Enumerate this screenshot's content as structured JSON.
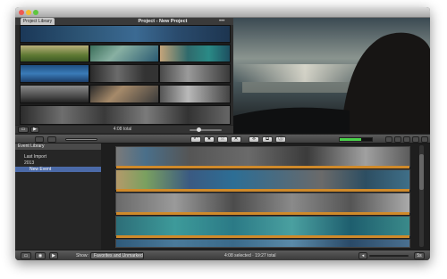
{
  "window": {
    "project_library_tab": "Project Library",
    "project_title": "Project - New Project",
    "more_dots": "•••"
  },
  "project_footer": {
    "total": "4:08 total"
  },
  "toolbar": {
    "tools": [
      "↶",
      "★",
      "☆",
      "✕",
      "⟡",
      "⧉",
      "⓵"
    ]
  },
  "event_library": {
    "header": "Event Library",
    "items": [
      "Last Import",
      "2013",
      "New Event"
    ]
  },
  "bottom_bar": {
    "show_label": "Show:",
    "show_value": "Favorites and Unmarked",
    "status": "4:08 selected · 19:27 total",
    "scale_label": "5s"
  }
}
